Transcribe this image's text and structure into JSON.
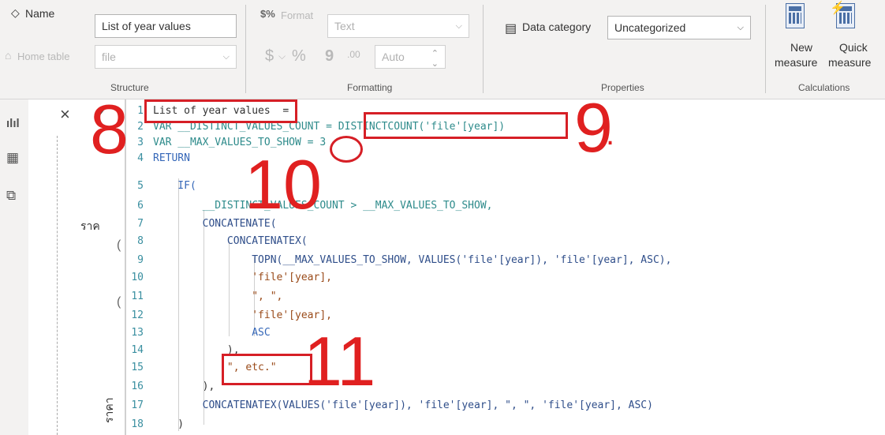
{
  "ribbon": {
    "structure": {
      "name_label": "Name",
      "name_value": "List of year values",
      "home_table_label": "Home table",
      "home_table_value": "file",
      "group_label": "Structure"
    },
    "formatting": {
      "format_label": "Format",
      "format_value": "Text",
      "currency_symbol": "$",
      "percent_symbol": "%",
      "comma_symbol": "9",
      "decimal_symbol": ".00",
      "decimals_value": "Auto",
      "group_label": "Formatting"
    },
    "properties": {
      "data_category_label": "Data category",
      "data_category_value": "Uncategorized",
      "group_label": "Properties"
    },
    "calculations": {
      "new_measure_line1": "New",
      "new_measure_line2": "measure",
      "quick_measure_line1": "Quick",
      "quick_measure_line2": "measure",
      "group_label": "Calculations"
    }
  },
  "formula_bar": {
    "cancel_symbol": "×",
    "commit_symbol": "✓"
  },
  "side_texts": {
    "thai_1": "ราค",
    "thai_2": "ราคา"
  },
  "code_lines": [
    {
      "n": "1",
      "text": "List of year values  ="
    },
    {
      "n": "2",
      "text": "VAR __DISTINCT_VALUES_COUNT = DISTINCTCOUNT('file'[year])"
    },
    {
      "n": "3",
      "text": "VAR __MAX_VALUES_TO_SHOW = 3"
    },
    {
      "n": "4",
      "text": "RETURN"
    },
    {
      "n": "5",
      "text": "    IF("
    },
    {
      "n": "6",
      "text": "        __DISTINCT_VALUES_COUNT > __MAX_VALUES_TO_SHOW,"
    },
    {
      "n": "7",
      "text": "        CONCATENATE("
    },
    {
      "n": "8",
      "text": "            CONCATENATEX("
    },
    {
      "n": "9",
      "text": "                TOPN(__MAX_VALUES_TO_SHOW, VALUES('file'[year]), 'file'[year], ASC),"
    },
    {
      "n": "10",
      "text": "                'file'[year],"
    },
    {
      "n": "11",
      "text": "                \", \","
    },
    {
      "n": "12",
      "text": "                'file'[year],"
    },
    {
      "n": "13",
      "text": "                ASC"
    },
    {
      "n": "14",
      "text": "            ),"
    },
    {
      "n": "15",
      "text": "            \", etc.\""
    },
    {
      "n": "16",
      "text": "        ),"
    },
    {
      "n": "17",
      "text": "        CONCATENATEX(VALUES('file'[year]), 'file'[year], \", \", 'file'[year], ASC)"
    },
    {
      "n": "18",
      "text": "    )"
    }
  ],
  "annotations": {
    "n8": "8",
    "n9": "9",
    "n10": "10",
    "n11": "11",
    "dot": "."
  },
  "colors": {
    "annotation_red": "#d61f26",
    "keyword_blue": "#3567b8",
    "line_number_teal": "#3a8fa0"
  }
}
